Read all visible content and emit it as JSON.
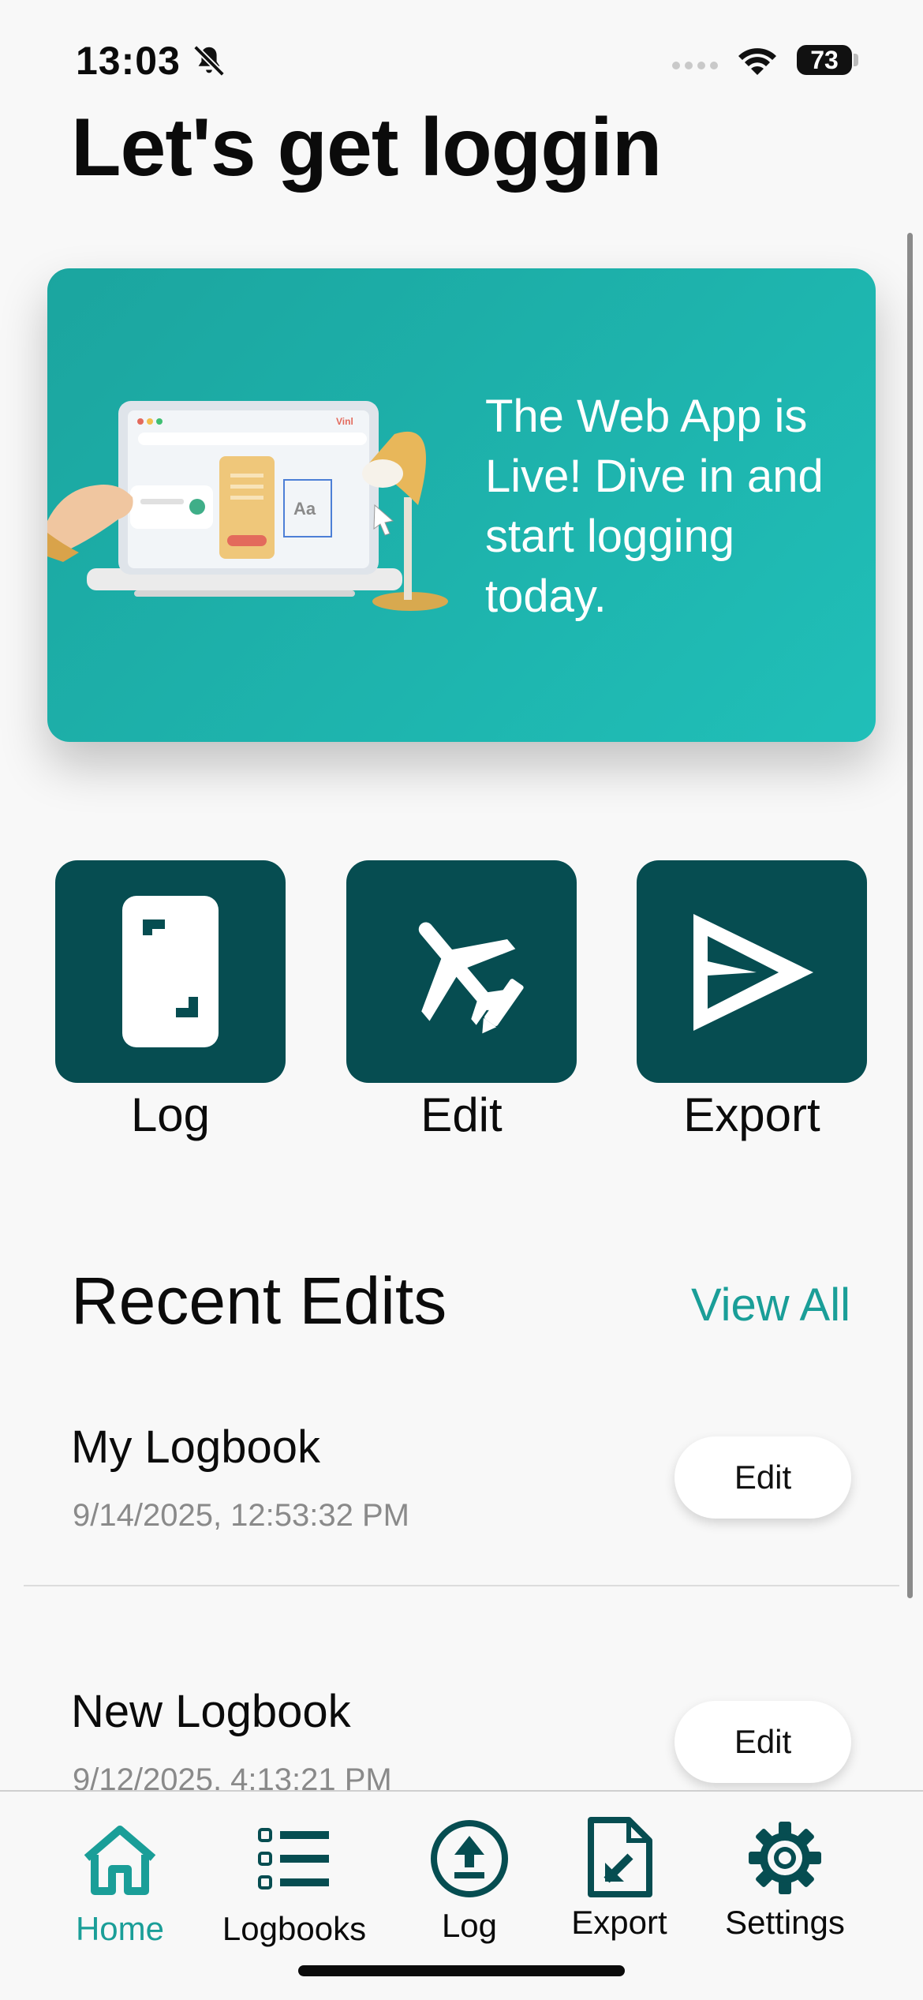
{
  "status_bar": {
    "time": "13:03",
    "battery": "73"
  },
  "page": {
    "title": "Let's get loggin"
  },
  "banner": {
    "text": "The Web App is Live! Dive in and start logging today.",
    "illustration_label": "Vinl"
  },
  "actions": [
    {
      "label": "Log",
      "icon": "phone-scan-icon"
    },
    {
      "label": "Edit",
      "icon": "plane-edit-icon"
    },
    {
      "label": "Export",
      "icon": "send-icon"
    }
  ],
  "recent": {
    "title": "Recent Edits",
    "view_all": "View All",
    "items": [
      {
        "name": "My Logbook",
        "date": "9/14/2025, 12:53:32 PM",
        "action": "Edit"
      },
      {
        "name": "New Logbook",
        "date": "9/12/2025, 4:13:21 PM",
        "action": "Edit"
      }
    ]
  },
  "tabs": [
    {
      "label": "Home",
      "icon": "home-icon",
      "active": true
    },
    {
      "label": "Logbooks",
      "icon": "list-icon",
      "active": false
    },
    {
      "label": "Log",
      "icon": "upload-circle-icon",
      "active": false
    },
    {
      "label": "Export",
      "icon": "file-export-icon",
      "active": false
    },
    {
      "label": "Settings",
      "icon": "gear-icon",
      "active": false
    }
  ],
  "colors": {
    "accent": "#1a9e98",
    "tile": "#064d51",
    "banner": "#1fb3ad"
  }
}
